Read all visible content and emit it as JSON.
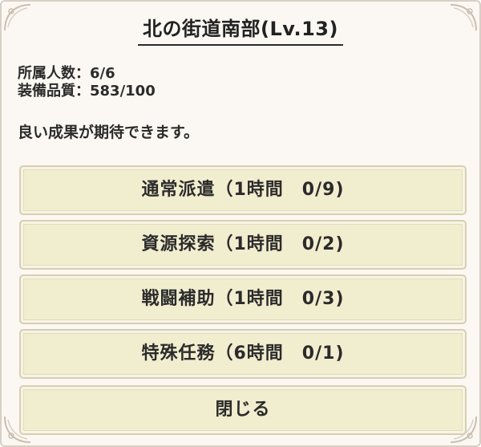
{
  "dialog": {
    "title": "北の街道南部(Lv.13)",
    "members": "所属人数：6/6",
    "equipment_quality": "装備品質：583/100",
    "description": "良い成果が期待できます。"
  },
  "missions": [
    {
      "label": "通常派遣（1時間　0/9)"
    },
    {
      "label": "資源探索（1時間　0/2)"
    },
    {
      "label": "戦闘補助（1時間　0/3)"
    },
    {
      "label": "特殊任務（6時間　0/1)"
    }
  ],
  "close_label": "閉じる",
  "colors": {
    "panel_bg": "#fbf8f3",
    "button_bg": "#f1edcf",
    "button_border": "#d6cfb4",
    "text": "#2b2b2b"
  },
  "icons": [
    "corner-ornament-icon"
  ]
}
